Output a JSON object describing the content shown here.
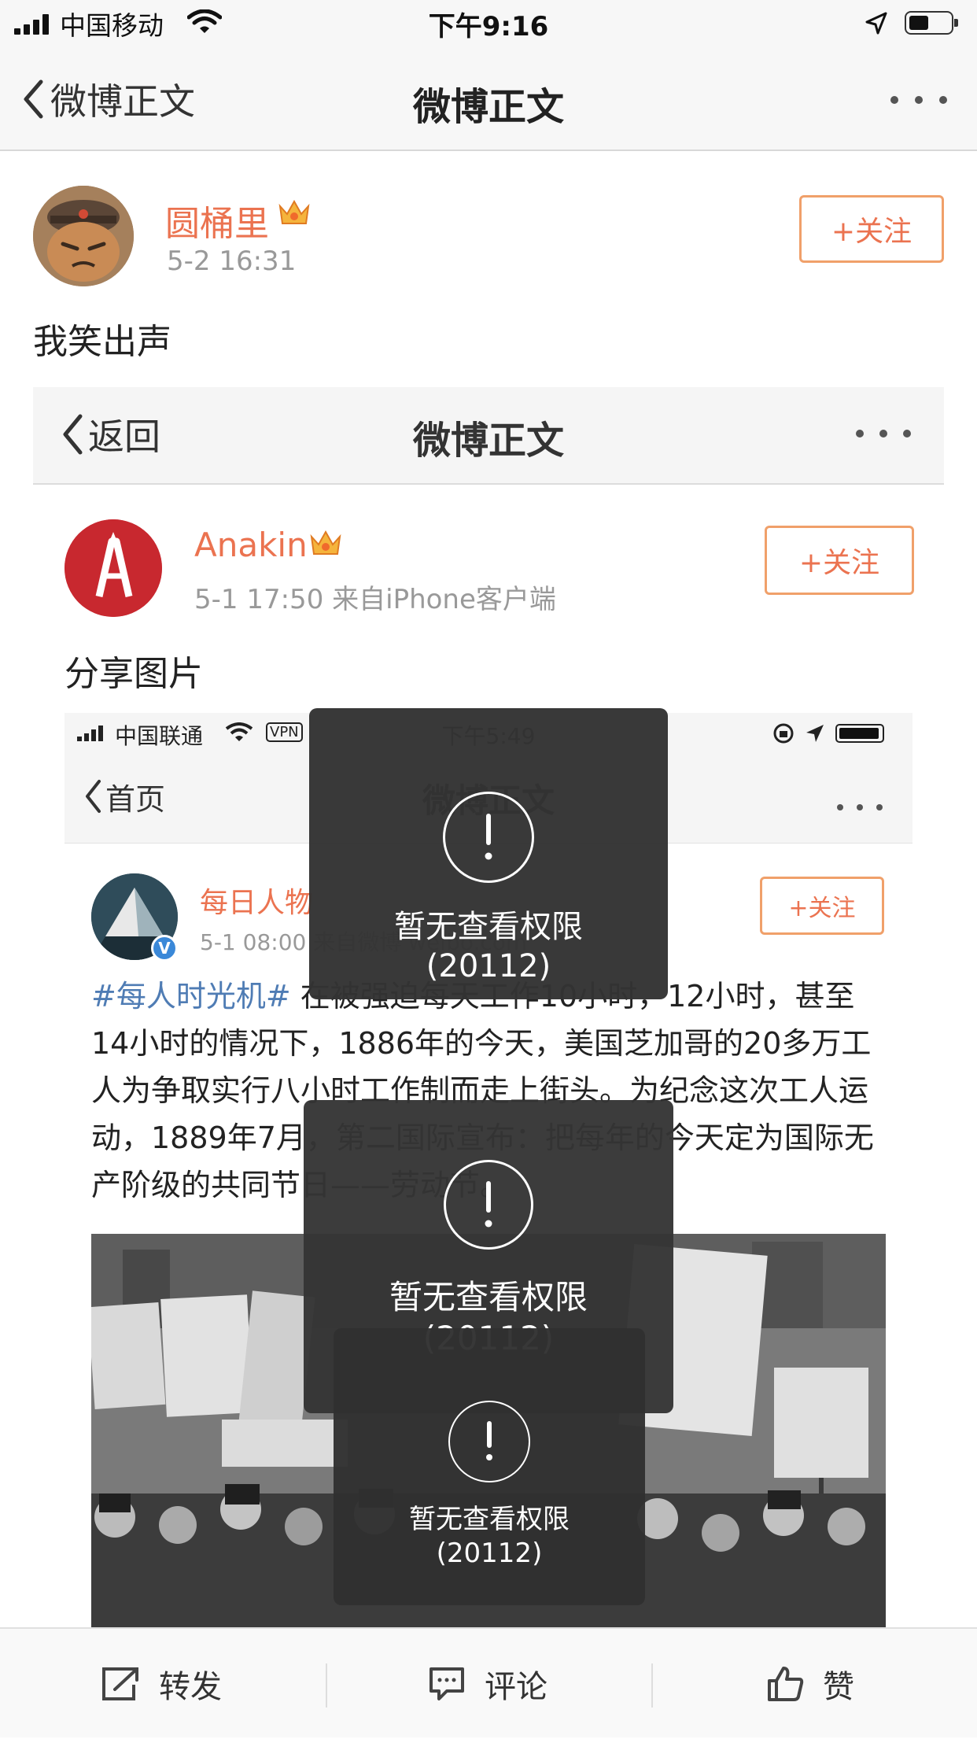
{
  "status_bar": {
    "carrier": "中国移动",
    "time": "下午9:16"
  },
  "nav": {
    "back_label": "微博正文",
    "title": "微博正文"
  },
  "post": {
    "username": "圆桶里",
    "time": "5-2 16:31",
    "follow_label": "+关注",
    "text": "我笑出声"
  },
  "screenshot1": {
    "back_label": "返回",
    "title": "微博正文",
    "username": "Anakin",
    "meta": "5-1 17:50  来自iPhone客户端",
    "follow_label": "+关注",
    "text": "分享图片"
  },
  "screenshot2": {
    "carrier": "中国联通",
    "vpn": "VPN",
    "time": "下午5:49",
    "back_label": "首页",
    "title": "微博正文",
    "username": "每日人物",
    "meta": "5-1 08:00  来自微博 weibo.com",
    "follow_label": "+关注",
    "hashtag": "#每人时光机#",
    "body": " 在被强迫每天工作10小时，12小时，甚至14小时的情况下，1886年的今天，美国芝加哥的20多万工人为争取实行八小时工作制而走上街头。为纪念这次工人运动，1889年7月，第二国际宣布：把每年的今天定为国际无产阶级的共同节日——劳动节。"
  },
  "toasts": [
    {
      "message": "暂无查看权限",
      "code": "(20112)"
    },
    {
      "message": "暂无查看权限",
      "code": "(20112)"
    },
    {
      "message": "暂无查看权限",
      "code": "(20112)"
    }
  ],
  "toolbar": {
    "repost_label": "转发",
    "comment_label": "评论",
    "like_label": "赞"
  },
  "colors": {
    "username": "#eb7350",
    "follow_border": "#f0a06a",
    "hashtag": "#4f7cb4",
    "toast_bg": "#333333"
  }
}
